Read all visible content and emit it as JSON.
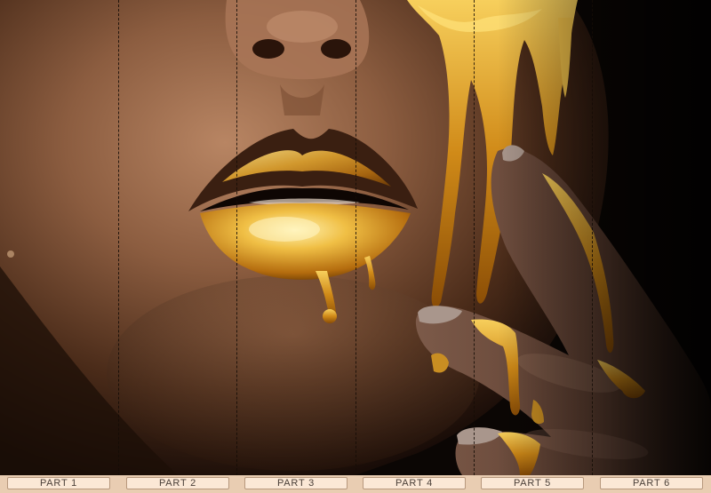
{
  "parts": [
    "PART 1",
    "PART 2",
    "PART 3",
    "PART 4",
    "PART 5",
    "PART 6"
  ],
  "colors": {
    "background": "#000000",
    "skin_light": "#b07c5a",
    "skin_dark": "#2d180d",
    "gold": "#e0a82e",
    "gold_highlight": "#ffe58a",
    "parts_bar": "#e9cdb2",
    "part_label_bg": "#fbe8d6",
    "part_label_text": "#4a3f38"
  }
}
